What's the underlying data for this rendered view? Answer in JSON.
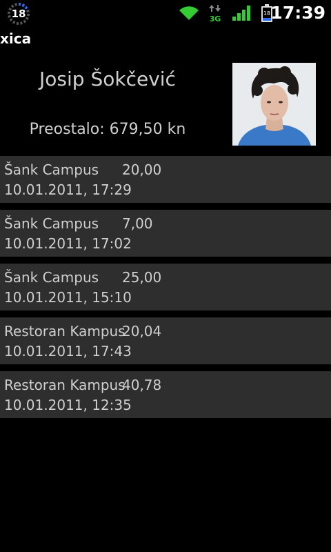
{
  "status_bar": {
    "notification_count": "18",
    "battery_level": "18",
    "network_type": "3G",
    "time": "17:39",
    "accent_color": "#33cc33"
  },
  "app": {
    "title": "xica"
  },
  "header": {
    "name": "Josip Šokčević",
    "balance": "Preostalo: 679,50 kn"
  },
  "transactions": [
    {
      "place": "Šank Campus",
      "amount": "20,00",
      "datetime": "10.01.2011, 17:29"
    },
    {
      "place": "Šank Campus",
      "amount": "7,00",
      "datetime": "10.01.2011, 17:02"
    },
    {
      "place": "Šank Campus",
      "amount": "25,00",
      "datetime": "10.01.2011, 15:10"
    },
    {
      "place": "Restoran Kampus",
      "amount": "20,04",
      "datetime": "10.01.2011, 17:43"
    },
    {
      "place": "Restoran Kampus",
      "amount": "40,78",
      "datetime": "10.01.2011, 12:35"
    }
  ]
}
